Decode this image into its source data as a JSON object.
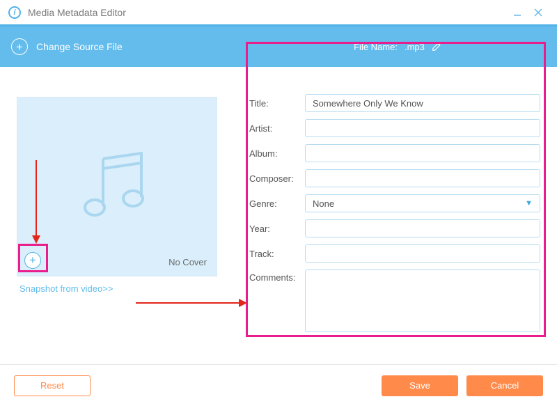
{
  "app": {
    "title": "Media Metadata Editor"
  },
  "toolbar": {
    "change_source": "Change Source File",
    "file_name_label": "File Name:",
    "file_name_value": ".mp3"
  },
  "cover": {
    "no_cover": "No Cover",
    "snapshot": "Snapshot from video>>"
  },
  "form": {
    "labels": {
      "title": "Title:",
      "artist": "Artist:",
      "album": "Album:",
      "composer": "Composer:",
      "genre": "Genre:",
      "year": "Year:",
      "track": "Track:",
      "comments": "Comments:"
    },
    "values": {
      "title": "Somewhere Only We Know",
      "artist": "",
      "album": "",
      "composer": "",
      "genre": "None",
      "year": "",
      "track": "",
      "comments": ""
    }
  },
  "footer": {
    "reset": "Reset",
    "save": "Save",
    "cancel": "Cancel"
  }
}
